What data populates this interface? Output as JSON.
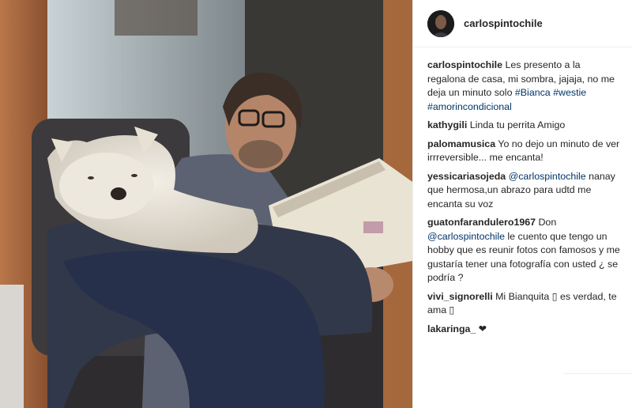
{
  "header": {
    "username": "carlospintochile"
  },
  "caption": {
    "user": "carlospintochile",
    "text": " Les presento a la regalona de casa, mi sombra, jajaja, no me deja un minuto solo ",
    "tags": [
      "#Bianca",
      "#westie",
      "#amorincondicional"
    ]
  },
  "comments": [
    {
      "user": "kathygili",
      "text": " Linda tu perrita Amigo"
    },
    {
      "user": "palomamusica",
      "text": " Yo no dejo un minuto de ver irrreversible... me encanta!"
    },
    {
      "user": "yessicariasojeda",
      "mention": "@carlospintochile",
      "text": " nanay que hermosa,un abrazo para udtd me encanta su voz"
    },
    {
      "user": "guatonfarandulero1967",
      "text_before": " Don ",
      "mention": "@carlospintochile",
      "text": " le cuento que tengo un hobby que es reunir fotos con famosos y me gustaría tener una fotografía con usted ¿ se podría ?"
    },
    {
      "user": "vivi_signorelli",
      "text": " Mi Bianquita ▯ es verdad, te ama ▯"
    },
    {
      "user": "lakaringa_",
      "text": " ❤"
    }
  ],
  "colors": {
    "link": "#003569",
    "text": "#262626",
    "border": "#efefef"
  }
}
